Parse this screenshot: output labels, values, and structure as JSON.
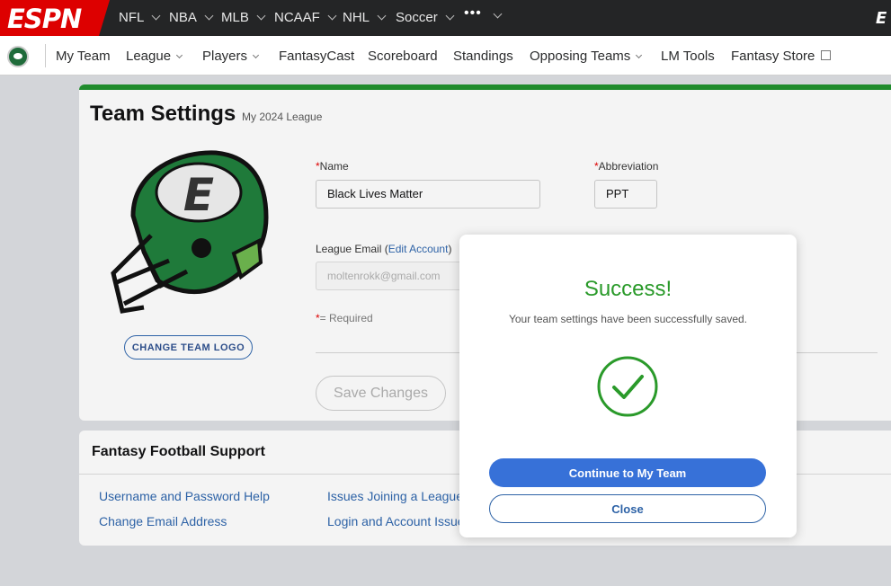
{
  "header": {
    "logo_text": "ESPN",
    "sports": [
      "NFL",
      "NBA",
      "MLB",
      "NCAAF",
      "NHL",
      "Soccer"
    ],
    "more_label": "•••"
  },
  "subnav": {
    "items": [
      "My Team",
      "League",
      "Players",
      "FantasyCast",
      "Scoreboard",
      "Standings",
      "Opposing Teams",
      "LM Tools",
      "Fantasy Store"
    ]
  },
  "team_settings": {
    "title": "Team Settings",
    "league_name": "My 2024 League",
    "change_logo_label": "CHANGE TEAM LOGO",
    "required_marker": "*",
    "name_label": "Name",
    "name_value": "Black Lives Matter",
    "abbr_label": "Abbreviation",
    "abbr_value": "PPT",
    "email_label": "League Email (",
    "email_link": "Edit Account",
    "email_close": ")",
    "email_placeholder": "moltenrokk@gmail.com",
    "required_note": "= Required",
    "save_label": "Save Changes"
  },
  "support": {
    "title": "Fantasy Football Support",
    "links": [
      "Username and Password Help",
      "Change Email Address",
      "Issues Joining a League",
      "Login and Account Issues"
    ]
  },
  "modal": {
    "title": "Success!",
    "message": "Your team settings have been successfully saved.",
    "primary_label": "Continue to My Team",
    "secondary_label": "Close"
  },
  "colors": {
    "brand_red": "#dd0000",
    "success_green": "#2a9a2a",
    "accent_blue": "#3771d8",
    "team_green": "#1f7a3a"
  }
}
